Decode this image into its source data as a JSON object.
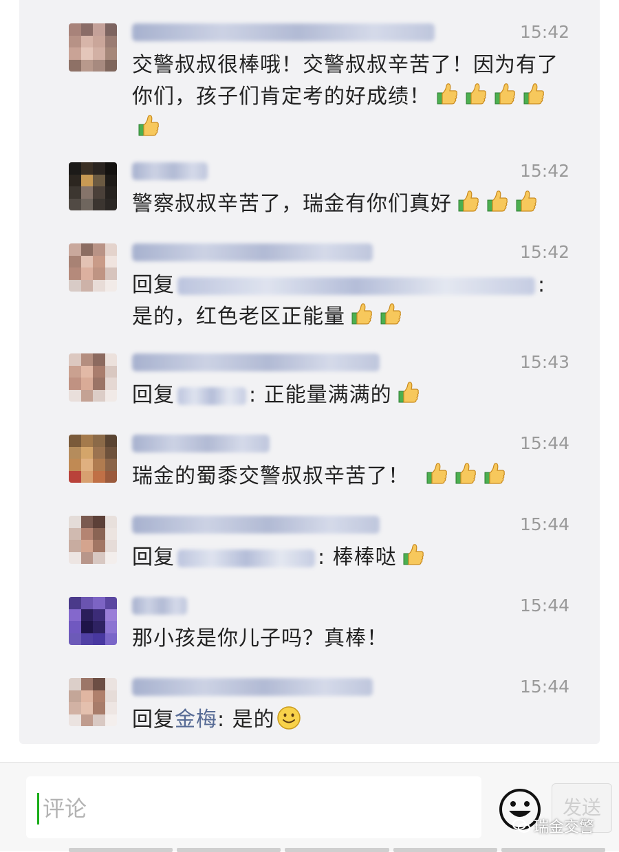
{
  "comments": [
    {
      "time": "15:42",
      "text": "交警叔叔很棒哦！交警叔叔辛苦了！因为有了你们，孩子们肯定考的好成绩！",
      "thumbs": 5
    },
    {
      "time": "15:42",
      "text": "警察叔叔辛苦了，瑞金有你们真好",
      "thumbs": 3
    },
    {
      "time": "15:42",
      "reply_prefix": "回复",
      "reply_suffix": ": 是的，红色老区正能量",
      "thumbs": 2
    },
    {
      "time": "15:43",
      "reply_prefix": "回复",
      "reply_suffix": ": 正能量满满的",
      "thumbs": 1
    },
    {
      "time": "15:44",
      "text": "瑞金的蜀黍交警叔叔辛苦了！",
      "thumbs": 3
    },
    {
      "time": "15:44",
      "reply_prefix": "回复",
      "reply_suffix": ": 棒棒哒",
      "thumbs": 1
    },
    {
      "time": "15:44",
      "text": "那小孩是你儿子吗？真棒！",
      "thumbs": 0
    },
    {
      "time": "15:44",
      "reply_prefix": "回复",
      "reply_name": "金梅",
      "reply_suffix": ": 是的",
      "smile": true
    }
  ],
  "input": {
    "placeholder": "评论"
  },
  "send_label": "发送",
  "watermark": "瑞金交警",
  "colors": {
    "link": "#576b95",
    "caret": "#1aad19",
    "time": "#9a9a9a"
  }
}
